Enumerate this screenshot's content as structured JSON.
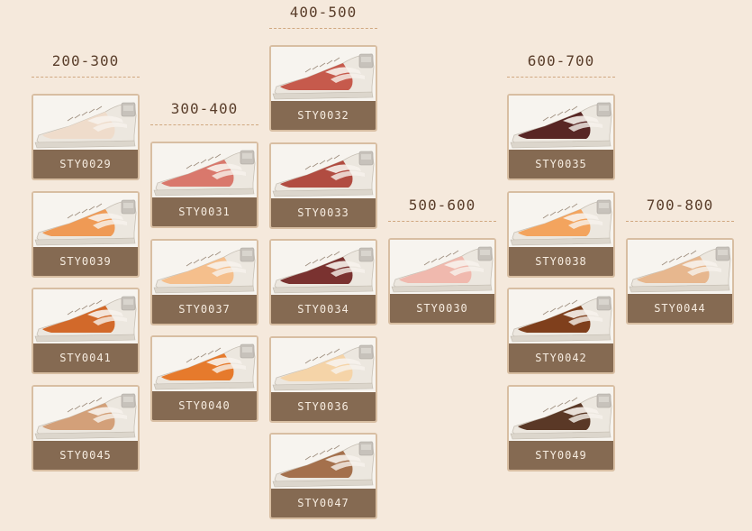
{
  "groups": [
    {
      "range": "200-300",
      "items": [
        {
          "code": "STY0029",
          "color": "#efdccb"
        },
        {
          "code": "STY0039",
          "color": "#ef9a55"
        },
        {
          "code": "STY0041",
          "color": "#d2692a"
        },
        {
          "code": "STY0045",
          "color": "#d3a079"
        }
      ]
    },
    {
      "range": "300-400",
      "items": [
        {
          "code": "STY0031",
          "color": "#d9786c"
        },
        {
          "code": "STY0037",
          "color": "#f5bf8c"
        },
        {
          "code": "STY0040",
          "color": "#e67a2c"
        }
      ]
    },
    {
      "range": "400-500",
      "items": [
        {
          "code": "STY0032",
          "color": "#c65a4c"
        },
        {
          "code": "STY0033",
          "color": "#b14c41"
        },
        {
          "code": "STY0034",
          "color": "#7a3230"
        },
        {
          "code": "STY0036",
          "color": "#f5d4a8"
        },
        {
          "code": "STY0047",
          "color": "#a4704c"
        }
      ]
    },
    {
      "range": "500-600",
      "items": [
        {
          "code": "STY0030",
          "color": "#f0b9ae"
        }
      ]
    },
    {
      "range": "600-700",
      "items": [
        {
          "code": "STY0035",
          "color": "#582624"
        },
        {
          "code": "STY0038",
          "color": "#f3a45e"
        },
        {
          "code": "STY0042",
          "color": "#7f3f1c"
        },
        {
          "code": "STY0049",
          "color": "#5a3826"
        }
      ]
    },
    {
      "range": "700-800",
      "items": [
        {
          "code": "STY0044",
          "color": "#e7b78e"
        }
      ]
    }
  ]
}
